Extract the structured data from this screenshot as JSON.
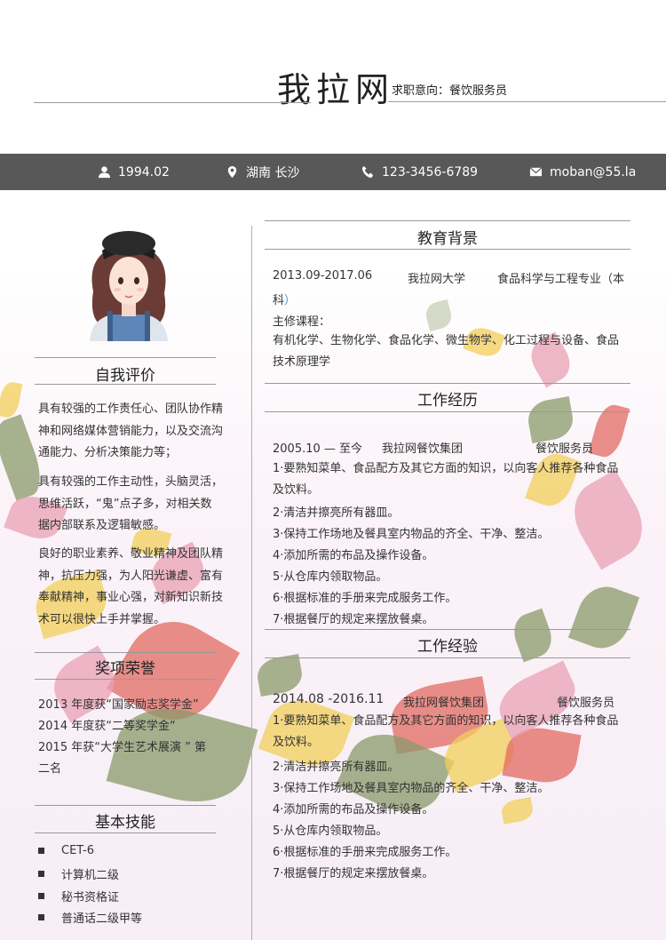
{
  "header": {
    "name": "我拉网",
    "intent": "求职意向：餐饮服务员"
  },
  "infobar": {
    "birth": "1994.02",
    "location": "湖南 长沙",
    "phone": "123-3456-6789",
    "email": "moban@55.la"
  },
  "left": {
    "self_eval": {
      "title": "自我评价",
      "p1": "具有较强的工作责任心、团队协作精神和网络媒体营销能力，以及交流沟通能力、分析决策能力等；",
      "p2": "具有较强的工作主动性，头脑灵活，思维活跃，“鬼”点子多，对相关数据内部联系及逻辑敏感。",
      "p3": "良好的职业素养、敬业精神及团队精神，抗压力强，为人阳光谦虚、富有奉献精神，事业心强，对新知识新技术可以很快上手并掌握。"
    },
    "awards": {
      "title": "奖项荣誉",
      "items": [
        "2013 年度获“国家励志奖学金”",
        "2014 年度获“二等奖学金“",
        "2015 年获“大学生艺术展演 ” 第",
        "二名"
      ]
    },
    "skills": {
      "title": "基本技能",
      "items": [
        "CET-6",
        "计算机二级",
        "秘书资格证",
        "普通话二级甲等"
      ]
    }
  },
  "right": {
    "education": {
      "title": "教育背景",
      "period": "2013.09-2017.06",
      "school": "我拉网大学",
      "major": "食品科学与工程专业（本",
      "major_cont": "科",
      "major_close": "）",
      "courses_label": "主修课程：",
      "courses": "有机化学、生物化学、食品化学、微生物学、化工过程与设备、食品技术原理学"
    },
    "work": {
      "title": "工作经历",
      "period": "2005.10 — 至今",
      "company": "我拉网餐饮集团",
      "role": "餐饮服务员",
      "duties": [
        "1·要熟知菜单、食品配方及其它方面的知识，以向客人推荐各种食品及饮料。",
        "2·清洁并擦亮所有器皿。",
        "3·保持工作场地及餐具室内物品的齐全、干净、整洁。",
        "4·添加所需的布品及操作设备。",
        "5·从仓库内领取物品。",
        "6·根据标准的手册来完成服务工作。",
        "7·根据餐厅的规定来摆放餐桌。"
      ]
    },
    "experience": {
      "title": "工作经验",
      "period": "2014.08 -2016.11",
      "company": "我拉网餐饮集团",
      "role": "餐饮服务员",
      "duties": [
        "1·要熟知菜单、食品配方及其它方面的知识，以向客人推荐各种食品及饮料。",
        "2·清洁并擦亮所有器皿。",
        "3·保持工作场地及餐具室内物品的齐全、干净、整洁。",
        "4·添加所需的布品及操作设备。",
        "5·从仓库内领取物品。",
        "6·根据标准的手册来完成服务工作。",
        "7·根据餐厅的规定来摆放餐桌。"
      ]
    }
  },
  "colors": {
    "bar": "#585858",
    "accent_blue": "#3a9ad9",
    "leaf_green": "#8a9a6a",
    "leaf_pink": "#e8a0b4",
    "leaf_red": "#e26a62",
    "leaf_yellow": "#f2cf5a"
  }
}
